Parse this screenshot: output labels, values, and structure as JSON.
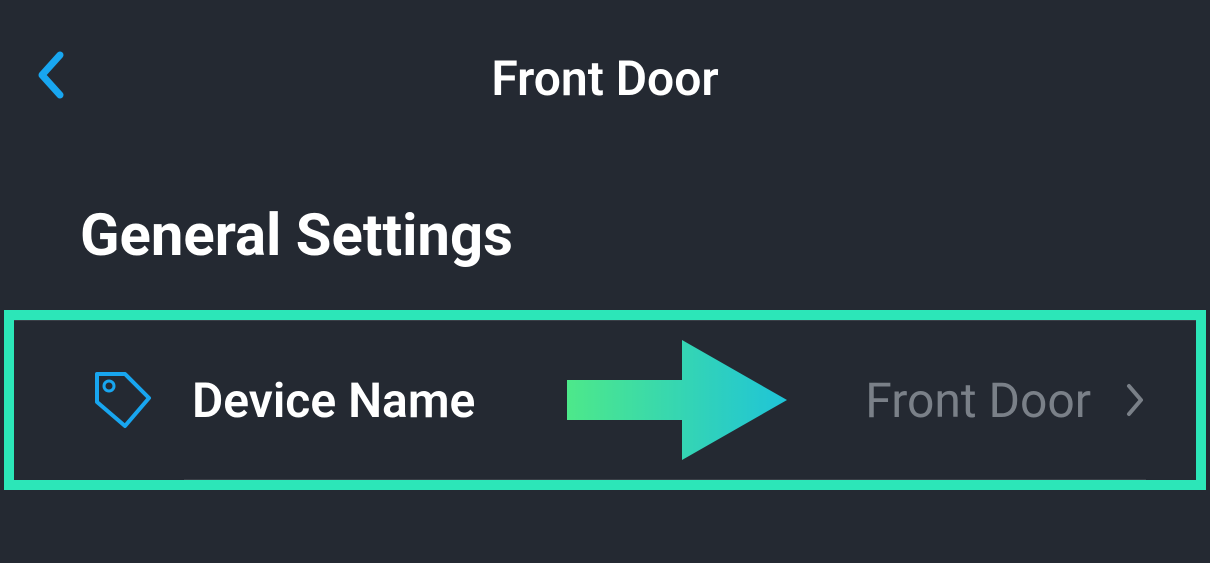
{
  "header": {
    "title": "Front Door"
  },
  "section": {
    "title": "General Settings"
  },
  "row": {
    "label": "Device Name",
    "value": "Front Door"
  },
  "colors": {
    "accent": "#18a6f0",
    "highlight": "#2ce6b8"
  }
}
